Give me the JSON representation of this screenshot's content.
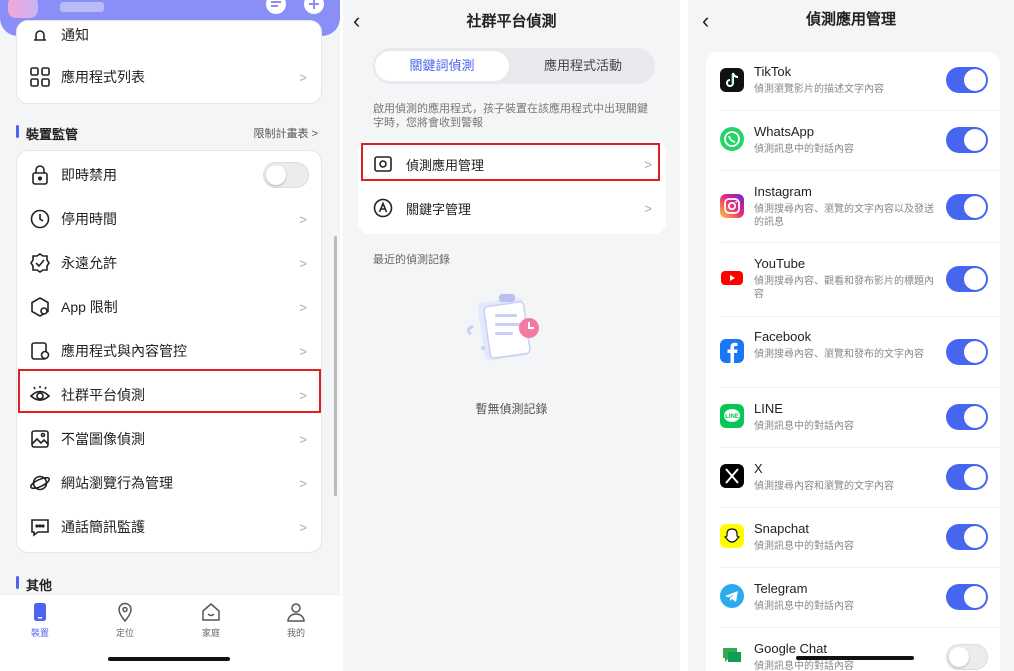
{
  "panel1": {
    "top_row_label": "通知",
    "app_list_label": "應用程式列表",
    "section_device": "裝置監管",
    "section_device_link": "限制計畫表",
    "items": [
      {
        "label": "即時禁用"
      },
      {
        "label": "停用時間"
      },
      {
        "label": "永遠允許"
      },
      {
        "label": "App 限制"
      },
      {
        "label": "應用程式與內容管控"
      },
      {
        "label": "社群平台偵測"
      },
      {
        "label": "不當圖像偵測"
      },
      {
        "label": "網站瀏覽行為管理"
      },
      {
        "label": "通話簡訊監護"
      }
    ],
    "section_other": "其他",
    "tabs": [
      {
        "label": "裝置"
      },
      {
        "label": "定位"
      },
      {
        "label": "家庭"
      },
      {
        "label": "我的"
      }
    ],
    "accent": "#4e63f0",
    "header_color": "#8a8ef7",
    "highlight_color": "#e02020"
  },
  "panel2": {
    "title": "社群平台偵測",
    "tab_active": "關鍵詞偵測",
    "tab_inactive": "應用程式活動",
    "description": "啟用偵測的應用程式，孩子裝置在該應用程式中出現關鍵字時，您將會收到警報",
    "row1": "偵測應用管理",
    "row2": "關鍵字管理",
    "recent": "最近的偵測記錄",
    "empty": "暫無偵測記錄"
  },
  "panel3": {
    "title": "偵測應用管理",
    "apps": [
      {
        "name": "TikTok",
        "desc": "偵測瀏覽影片的描述文字內容",
        "enabled": true
      },
      {
        "name": "WhatsApp",
        "desc": "偵測訊息中的對話內容",
        "enabled": true
      },
      {
        "name": "Instagram",
        "desc": "偵測搜尋內容、瀏覽的文字內容以及發送的訊息",
        "enabled": true
      },
      {
        "name": "YouTube",
        "desc": "偵測搜尋內容、觀看和發布影片的標題內容",
        "enabled": true
      },
      {
        "name": "Facebook",
        "desc": "偵測搜尋內容、瀏覽和發布的文字內容",
        "enabled": true
      },
      {
        "name": "LINE",
        "desc": "偵測訊息中的對話內容",
        "enabled": true
      },
      {
        "name": "X",
        "desc": "偵測搜尋內容和瀏覽的文字內容",
        "enabled": true
      },
      {
        "name": "Snapchat",
        "desc": "偵測訊息中的對話內容",
        "enabled": true
      },
      {
        "name": "Telegram",
        "desc": "偵測訊息中的對話內容",
        "enabled": true
      },
      {
        "name": "Google Chat",
        "desc": "偵測訊息中的對話內容",
        "enabled": false
      }
    ]
  }
}
